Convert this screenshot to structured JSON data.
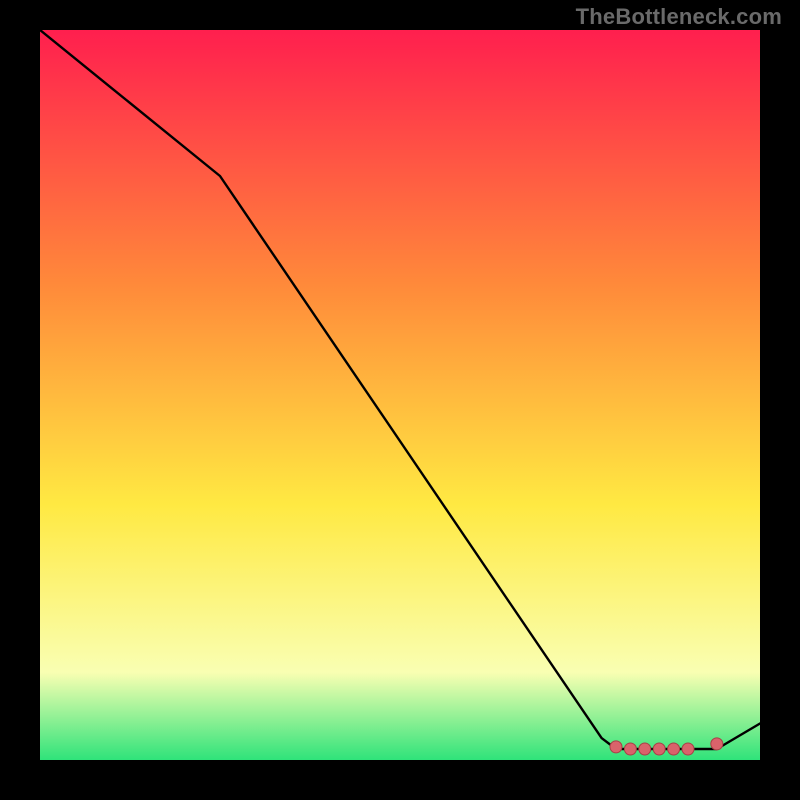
{
  "watermark": "TheBottleneck.com",
  "colors": {
    "page_bg": "#000000",
    "gradient_top": "#ff1f4e",
    "gradient_mid1": "#ff8a3a",
    "gradient_mid2": "#ffe942",
    "gradient_low": "#f9ffb2",
    "gradient_bottom": "#2fe37a",
    "curve": "#000000",
    "marker_fill": "#d9636b",
    "marker_stroke": "#a84047"
  },
  "chart_data": {
    "type": "line",
    "title": "",
    "xlabel": "",
    "ylabel": "",
    "xlim": [
      0,
      100
    ],
    "ylim": [
      0,
      100
    ],
    "series": [
      {
        "name": "bottleneck-curve",
        "x": [
          0,
          10,
          25,
          78,
          80,
          84,
          90,
          94,
          100
        ],
        "values": [
          100,
          92,
          80,
          3,
          1.5,
          1.5,
          1.5,
          1.5,
          5
        ]
      }
    ],
    "markers": [
      {
        "name": "flat-start",
        "x": 80,
        "y": 1.8
      },
      {
        "name": "flat-a",
        "x": 82,
        "y": 1.5
      },
      {
        "name": "flat-b",
        "x": 84,
        "y": 1.5
      },
      {
        "name": "flat-c",
        "x": 86,
        "y": 1.5
      },
      {
        "name": "flat-d",
        "x": 88,
        "y": 1.5
      },
      {
        "name": "flat-e",
        "x": 90,
        "y": 1.5
      },
      {
        "name": "upturn-point",
        "x": 94,
        "y": 2.2
      }
    ],
    "grid": false,
    "legend": false
  }
}
